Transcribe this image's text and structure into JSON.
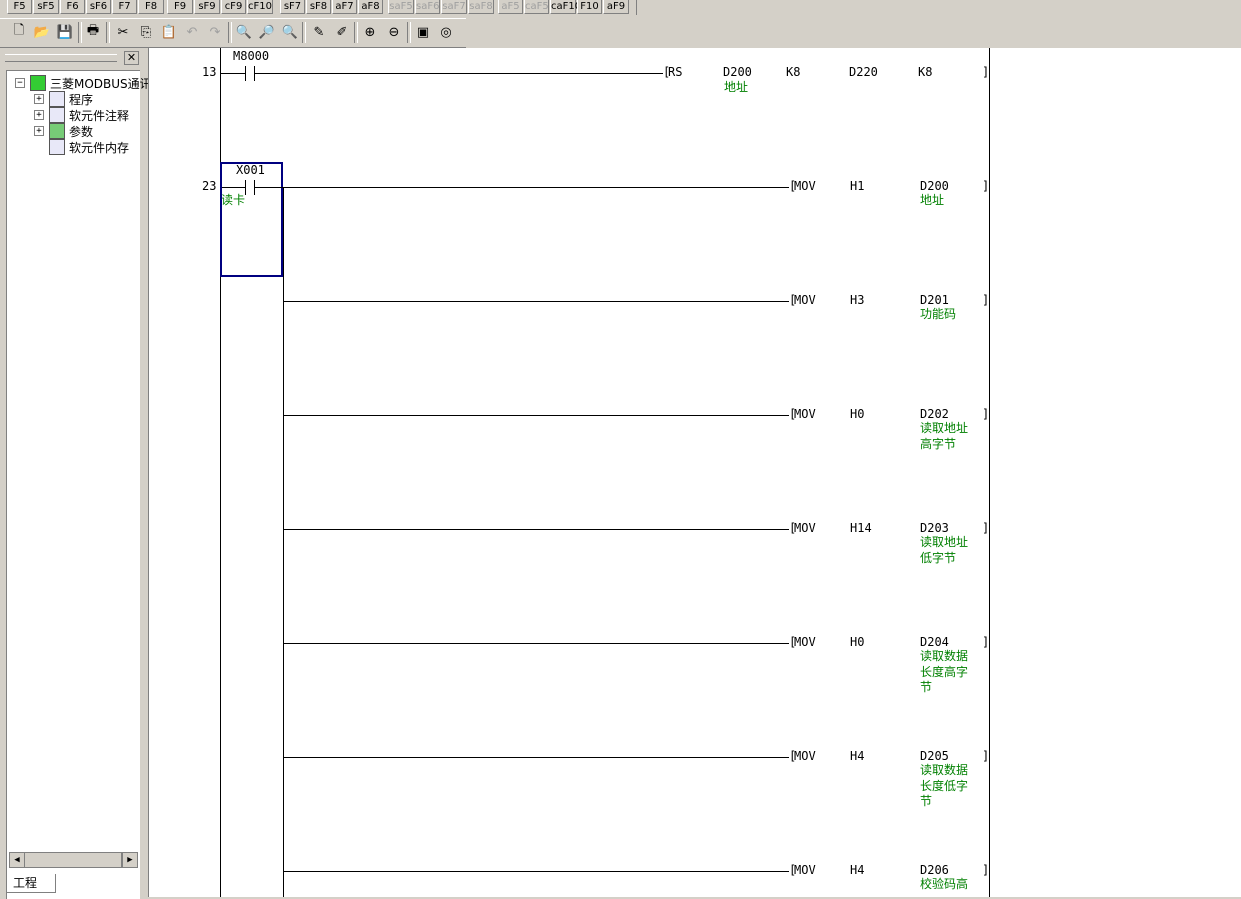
{
  "fkeys": [
    {
      "label": "F5",
      "disabled": false
    },
    {
      "label": "sF5",
      "disabled": false
    },
    {
      "label": "F6",
      "disabled": false
    },
    {
      "label": "sF6",
      "disabled": false
    },
    {
      "label": "F7",
      "disabled": false
    },
    {
      "label": "F8",
      "disabled": false
    },
    {
      "label": "F9",
      "disabled": false
    },
    {
      "label": "sF9",
      "disabled": false
    },
    {
      "label": "cF9",
      "disabled": false
    },
    {
      "label": "cF10",
      "disabled": false
    },
    {
      "label": "sF7",
      "disabled": false
    },
    {
      "label": "sF8",
      "disabled": false
    },
    {
      "label": "aF7",
      "disabled": false
    },
    {
      "label": "aF8",
      "disabled": false
    },
    {
      "label": "saF5",
      "disabled": true
    },
    {
      "label": "saF6",
      "disabled": true
    },
    {
      "label": "saF7",
      "disabled": true
    },
    {
      "label": "saF8",
      "disabled": true
    },
    {
      "label": "aF5",
      "disabled": true
    },
    {
      "label": "caF5",
      "disabled": true
    },
    {
      "label": "caF10",
      "disabled": false
    },
    {
      "label": "F10",
      "disabled": false
    },
    {
      "label": "aF9",
      "disabled": false
    }
  ],
  "toolbar": [
    {
      "icon": "new-file-icon",
      "glyph": "🗋"
    },
    {
      "icon": "open-folder-icon",
      "glyph": "📂"
    },
    {
      "icon": "save-icon",
      "glyph": "💾"
    },
    {
      "icon": "print-icon",
      "glyph": "🖶"
    },
    {
      "icon": "cut-icon",
      "glyph": "✂"
    },
    {
      "icon": "copy-icon",
      "glyph": "⎘"
    },
    {
      "icon": "paste-icon",
      "glyph": "📋"
    },
    {
      "icon": "undo-icon",
      "glyph": "↶"
    },
    {
      "icon": "redo-icon",
      "glyph": "↷"
    },
    {
      "icon": "find-device-icon",
      "glyph": "🔍"
    },
    {
      "icon": "find-instruction-icon",
      "glyph": "🔎"
    },
    {
      "icon": "find-step-icon",
      "glyph": "🔍"
    },
    {
      "icon": "comment-edit-icon",
      "glyph": "✎"
    },
    {
      "icon": "statement-edit-icon",
      "glyph": "✐"
    },
    {
      "icon": "zoom-in-icon",
      "glyph": "⊕"
    },
    {
      "icon": "zoom-out-icon",
      "glyph": "⊖"
    },
    {
      "icon": "monitor-icon",
      "glyph": "▣"
    },
    {
      "icon": "device-batch-icon",
      "glyph": "◎"
    }
  ],
  "tree": {
    "root": "三菱MODBUS通讯",
    "items": [
      "程序",
      "软元件注释",
      "参数",
      "软元件内存"
    ]
  },
  "panel_tab": "工程",
  "ladder": {
    "rung1": {
      "step": "13",
      "contact": "M8000",
      "instr": "RS",
      "op1": "D200",
      "op1_comment": "地址",
      "op2": "K8",
      "op3": "D220",
      "op4": "K8"
    },
    "rung2": {
      "step": "23",
      "contact": "X001",
      "contact_comment": "读卡",
      "movs": [
        {
          "instr": "MOV",
          "src": "H1",
          "dst": "D200",
          "comment": "地址"
        },
        {
          "instr": "MOV",
          "src": "H3",
          "dst": "D201",
          "comment": "功能码"
        },
        {
          "instr": "MOV",
          "src": "H0",
          "dst": "D202",
          "comment": "读取地址\n高字节"
        },
        {
          "instr": "MOV",
          "src": "H14",
          "dst": "D203",
          "comment": "读取地址\n低字节"
        },
        {
          "instr": "MOV",
          "src": "H0",
          "dst": "D204",
          "comment": "读取数据\n长度高字\n节"
        },
        {
          "instr": "MOV",
          "src": "H4",
          "dst": "D205",
          "comment": "读取数据\n长度低字\n节"
        },
        {
          "instr": "MOV",
          "src": "H4",
          "dst": "D206",
          "comment": "校验码高"
        }
      ]
    }
  }
}
